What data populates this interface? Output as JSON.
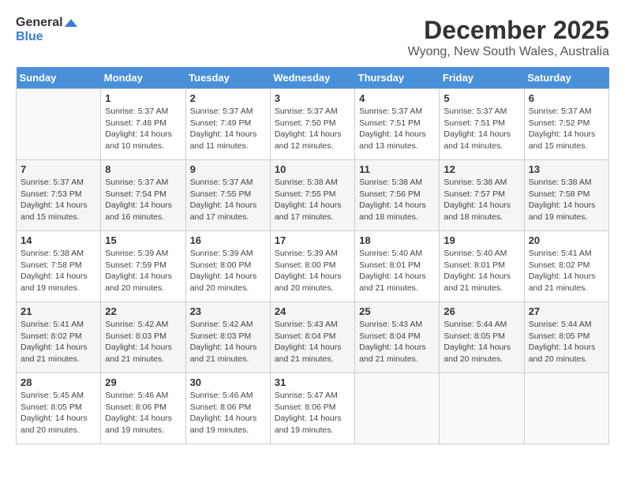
{
  "logo": {
    "text_general": "General",
    "text_blue": "Blue"
  },
  "title": "December 2025",
  "subtitle": "Wyong, New South Wales, Australia",
  "days_of_week": [
    "Sunday",
    "Monday",
    "Tuesday",
    "Wednesday",
    "Thursday",
    "Friday",
    "Saturday"
  ],
  "weeks": [
    [
      {
        "day": "",
        "info": ""
      },
      {
        "day": "1",
        "info": "Sunrise: 5:37 AM\nSunset: 7:48 PM\nDaylight: 14 hours\nand 10 minutes."
      },
      {
        "day": "2",
        "info": "Sunrise: 5:37 AM\nSunset: 7:49 PM\nDaylight: 14 hours\nand 11 minutes."
      },
      {
        "day": "3",
        "info": "Sunrise: 5:37 AM\nSunset: 7:50 PM\nDaylight: 14 hours\nand 12 minutes."
      },
      {
        "day": "4",
        "info": "Sunrise: 5:37 AM\nSunset: 7:51 PM\nDaylight: 14 hours\nand 13 minutes."
      },
      {
        "day": "5",
        "info": "Sunrise: 5:37 AM\nSunset: 7:51 PM\nDaylight: 14 hours\nand 14 minutes."
      },
      {
        "day": "6",
        "info": "Sunrise: 5:37 AM\nSunset: 7:52 PM\nDaylight: 14 hours\nand 15 minutes."
      }
    ],
    [
      {
        "day": "7",
        "info": "Sunrise: 5:37 AM\nSunset: 7:53 PM\nDaylight: 14 hours\nand 15 minutes."
      },
      {
        "day": "8",
        "info": "Sunrise: 5:37 AM\nSunset: 7:54 PM\nDaylight: 14 hours\nand 16 minutes."
      },
      {
        "day": "9",
        "info": "Sunrise: 5:37 AM\nSunset: 7:55 PM\nDaylight: 14 hours\nand 17 minutes."
      },
      {
        "day": "10",
        "info": "Sunrise: 5:38 AM\nSunset: 7:55 PM\nDaylight: 14 hours\nand 17 minutes."
      },
      {
        "day": "11",
        "info": "Sunrise: 5:38 AM\nSunset: 7:56 PM\nDaylight: 14 hours\nand 18 minutes."
      },
      {
        "day": "12",
        "info": "Sunrise: 5:38 AM\nSunset: 7:57 PM\nDaylight: 14 hours\nand 18 minutes."
      },
      {
        "day": "13",
        "info": "Sunrise: 5:38 AM\nSunset: 7:58 PM\nDaylight: 14 hours\nand 19 minutes."
      }
    ],
    [
      {
        "day": "14",
        "info": "Sunrise: 5:38 AM\nSunset: 7:58 PM\nDaylight: 14 hours\nand 19 minutes."
      },
      {
        "day": "15",
        "info": "Sunrise: 5:39 AM\nSunset: 7:59 PM\nDaylight: 14 hours\nand 20 minutes."
      },
      {
        "day": "16",
        "info": "Sunrise: 5:39 AM\nSunset: 8:00 PM\nDaylight: 14 hours\nand 20 minutes."
      },
      {
        "day": "17",
        "info": "Sunrise: 5:39 AM\nSunset: 8:00 PM\nDaylight: 14 hours\nand 20 minutes."
      },
      {
        "day": "18",
        "info": "Sunrise: 5:40 AM\nSunset: 8:01 PM\nDaylight: 14 hours\nand 21 minutes."
      },
      {
        "day": "19",
        "info": "Sunrise: 5:40 AM\nSunset: 8:01 PM\nDaylight: 14 hours\nand 21 minutes."
      },
      {
        "day": "20",
        "info": "Sunrise: 5:41 AM\nSunset: 8:02 PM\nDaylight: 14 hours\nand 21 minutes."
      }
    ],
    [
      {
        "day": "21",
        "info": "Sunrise: 5:41 AM\nSunset: 8:02 PM\nDaylight: 14 hours\nand 21 minutes."
      },
      {
        "day": "22",
        "info": "Sunrise: 5:42 AM\nSunset: 8:03 PM\nDaylight: 14 hours\nand 21 minutes."
      },
      {
        "day": "23",
        "info": "Sunrise: 5:42 AM\nSunset: 8:03 PM\nDaylight: 14 hours\nand 21 minutes."
      },
      {
        "day": "24",
        "info": "Sunrise: 5:43 AM\nSunset: 8:04 PM\nDaylight: 14 hours\nand 21 minutes."
      },
      {
        "day": "25",
        "info": "Sunrise: 5:43 AM\nSunset: 8:04 PM\nDaylight: 14 hours\nand 21 minutes."
      },
      {
        "day": "26",
        "info": "Sunrise: 5:44 AM\nSunset: 8:05 PM\nDaylight: 14 hours\nand 20 minutes."
      },
      {
        "day": "27",
        "info": "Sunrise: 5:44 AM\nSunset: 8:05 PM\nDaylight: 14 hours\nand 20 minutes."
      }
    ],
    [
      {
        "day": "28",
        "info": "Sunrise: 5:45 AM\nSunset: 8:05 PM\nDaylight: 14 hours\nand 20 minutes."
      },
      {
        "day": "29",
        "info": "Sunrise: 5:46 AM\nSunset: 8:06 PM\nDaylight: 14 hours\nand 19 minutes."
      },
      {
        "day": "30",
        "info": "Sunrise: 5:46 AM\nSunset: 8:06 PM\nDaylight: 14 hours\nand 19 minutes."
      },
      {
        "day": "31",
        "info": "Sunrise: 5:47 AM\nSunset: 8:06 PM\nDaylight: 14 hours\nand 19 minutes."
      },
      {
        "day": "",
        "info": ""
      },
      {
        "day": "",
        "info": ""
      },
      {
        "day": "",
        "info": ""
      }
    ]
  ]
}
